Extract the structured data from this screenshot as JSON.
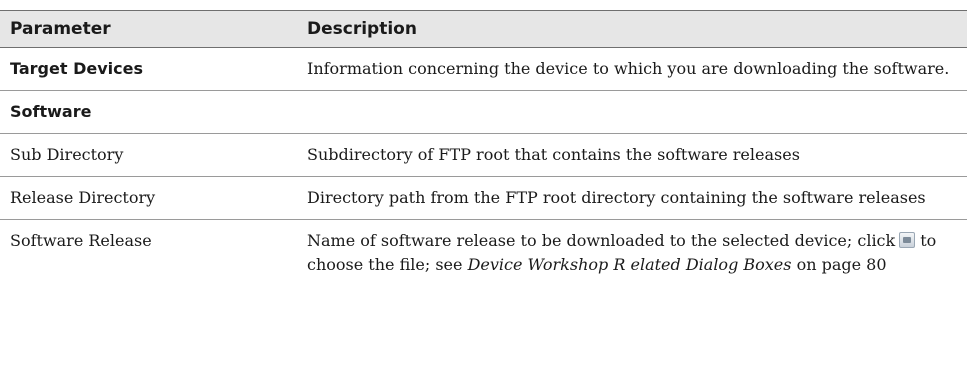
{
  "table": {
    "headers": {
      "parameter": "Parameter",
      "description": "Description"
    },
    "rows": {
      "target_devices": {
        "parameter": "Target Devices",
        "description": "Information concerning the device to which you are downloading the software."
      },
      "software_section": {
        "parameter": "Software"
      },
      "sub_directory": {
        "parameter": "Sub Directory",
        "description": "Subdirectory of FTP root that contains the software releases"
      },
      "release_directory": {
        "parameter": "Release Directory",
        "description": "Directory path from the FTP root directory containing the software releases"
      },
      "software_release": {
        "parameter": "Software Release",
        "description_before": "Name of software release to be downloaded to the selected device; click",
        "icon": "browse-button-icon",
        "description_after": "to choose the file; see",
        "reference": "Device Workshop R elated Dialog Boxes",
        "description_end": "on page 80"
      }
    }
  }
}
